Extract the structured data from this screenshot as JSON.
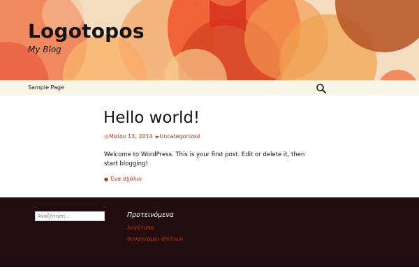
{
  "site": {
    "title": "Logotopos",
    "description": "My Blog"
  },
  "nav": {
    "items": [
      {
        "label": "Sample Page"
      }
    ],
    "search_icon": "search-icon"
  },
  "post": {
    "title": "Hello world!",
    "date": "Μαίου 13, 2014",
    "category": "Uncategorized",
    "content": "Welcome to WordPress. This is your first post. Edit or delete it, then start blogging!",
    "comments_label": "Ένα σχόλιο"
  },
  "footer": {
    "search": {
      "placeholder": "Αναζήτηση...",
      "value": ""
    },
    "widget": {
      "title": "Προτεινόμενα",
      "links": [
        {
          "label": "λογότυπα"
        },
        {
          "label": "συναγερμοι σπιτιων"
        }
      ]
    }
  },
  "colors": {
    "accent": "#bc360a",
    "header_bg": "#f3dcc0",
    "nav_bg": "#f7f5e7",
    "footer_bg": "#220e10",
    "text": "#141414"
  }
}
